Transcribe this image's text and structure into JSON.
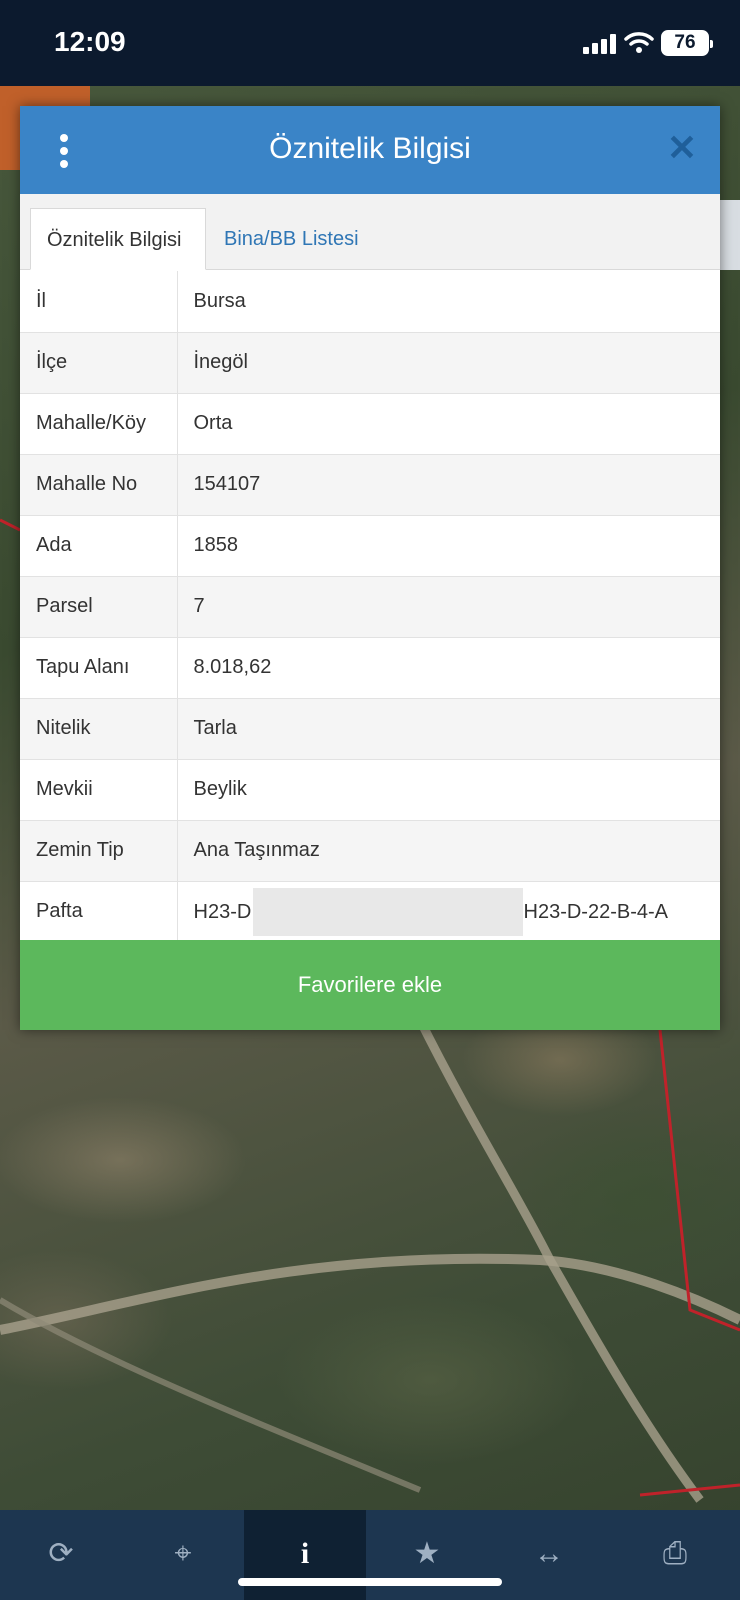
{
  "status": {
    "time": "12:09",
    "battery": "76"
  },
  "modal": {
    "title": "Öznitelik Bilgisi",
    "tabs": [
      {
        "label": "Öznitelik Bilgisi",
        "active": true
      },
      {
        "label": "Bina/BB Listesi",
        "active": false
      }
    ],
    "rows": [
      {
        "key": "İl",
        "value": "Bursa"
      },
      {
        "key": "İlçe",
        "value": "İnegöl"
      },
      {
        "key": "Mahalle/Köy",
        "value": "Orta"
      },
      {
        "key": "Mahalle No",
        "value": "154107"
      },
      {
        "key": "Ada",
        "value": "1858"
      },
      {
        "key": "Parsel",
        "value": "7"
      },
      {
        "key": "Tapu Alanı",
        "value": "8.018,62"
      },
      {
        "key": "Nitelik",
        "value": "Tarla"
      },
      {
        "key": "Mevkii",
        "value": "Beylik"
      },
      {
        "key": "Zemin Tip",
        "value": "Ana Taşınmaz"
      },
      {
        "key": "Pafta",
        "value_left": "H23-D",
        "value_right": "H23-D-22-B-4-A"
      }
    ],
    "favorite_button": "Favorilere ekle"
  },
  "toolbar": {
    "icons": [
      "refresh-icon",
      "crosshair-icon",
      "info-icon",
      "star-icon",
      "measure-icon",
      "print-icon"
    ],
    "active": "info-icon"
  },
  "colors": {
    "header": "#3a84c7",
    "favorite": "#5cb85c",
    "toolbar": "#1d3650",
    "parcel_border": "#c0222a"
  }
}
